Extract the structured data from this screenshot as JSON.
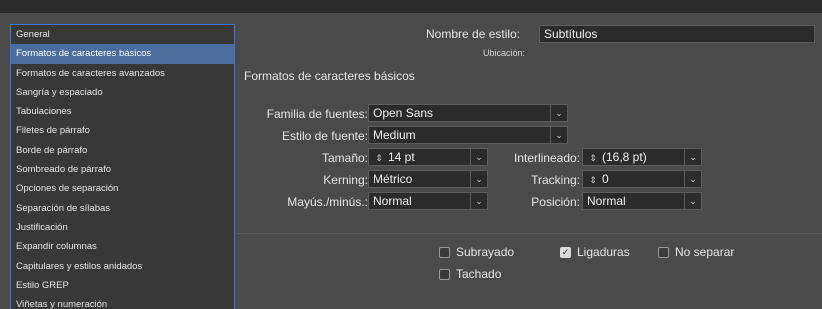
{
  "sidebar": {
    "items": [
      {
        "label": "General",
        "selected": false
      },
      {
        "label": "Formatos de caracteres básicos",
        "selected": true
      },
      {
        "label": "Formatos de caracteres avanzados",
        "selected": false
      },
      {
        "label": "Sangría y espaciado",
        "selected": false
      },
      {
        "label": "Tabulaciones",
        "selected": false
      },
      {
        "label": "Filetes de párrafo",
        "selected": false
      },
      {
        "label": "Borde de párrafo",
        "selected": false
      },
      {
        "label": "Sombreado de párrafo",
        "selected": false
      },
      {
        "label": "Opciones de separación",
        "selected": false
      },
      {
        "label": "Separación de sílabas",
        "selected": false
      },
      {
        "label": "Justificación",
        "selected": false
      },
      {
        "label": "Expandir columnas",
        "selected": false
      },
      {
        "label": "Capitulares y estilos anidados",
        "selected": false
      },
      {
        "label": "Estilo GREP",
        "selected": false
      },
      {
        "label": "Viñetas y numeración",
        "selected": false
      }
    ]
  },
  "style": {
    "name_label": "Nombre de estilo:",
    "name_value": "Subtítulos",
    "location_label": "Ubicación:"
  },
  "section": {
    "title": "Formatos de caracteres básicos"
  },
  "form": {
    "font_family_label": "Familia de fuentes:",
    "font_family_value": "Open Sans",
    "font_style_label": "Estilo de fuente:",
    "font_style_value": "Medium",
    "size_label": "Tamaño:",
    "size_value": "14 pt",
    "leading_label": "Interlineado:",
    "leading_value": "(16,8 pt)",
    "kerning_label": "Kerning:",
    "kerning_value": "Métrico",
    "tracking_label": "Tracking:",
    "tracking_value": "0",
    "case_label": "Mayús./minús.:",
    "case_value": "Normal",
    "position_label": "Posición:",
    "position_value": "Normal"
  },
  "options": {
    "underline": {
      "label": "Subrayado",
      "checked": false
    },
    "ligatures": {
      "label": "Ligaduras",
      "checked": true
    },
    "no_break": {
      "label": "No separar",
      "checked": false
    },
    "strikethrough": {
      "label": "Tachado",
      "checked": false
    }
  },
  "icons": {
    "dropdown": "chevron-down-icon",
    "spinner": "stepper-icon",
    "checkmark": "checkmark-icon"
  },
  "colors": {
    "panel": "#4a4a4a",
    "sidebar": "#383838",
    "selection": "#4a6d9e",
    "focus_border": "#3a7bd5"
  }
}
